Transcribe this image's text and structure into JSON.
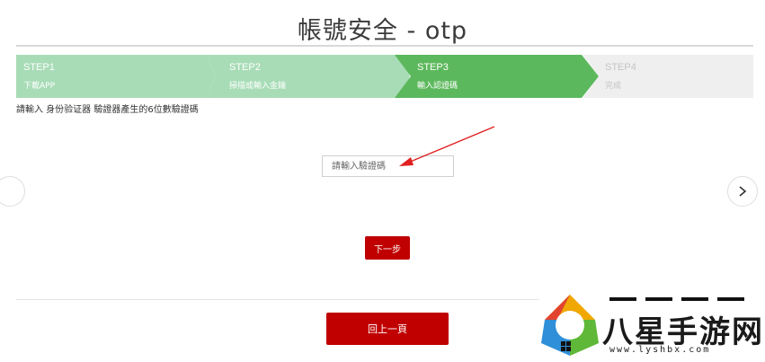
{
  "page": {
    "title": "帳號安全 - otp"
  },
  "steps": [
    {
      "label": "STEP1",
      "desc": "下載APP",
      "state": "done"
    },
    {
      "label": "STEP2",
      "desc": "掃描或輸入金鑰",
      "state": "done"
    },
    {
      "label": "STEP3",
      "desc": "輸入認證碼",
      "state": "active"
    },
    {
      "label": "STEP4",
      "desc": "完成",
      "state": "todo"
    }
  ],
  "instruction": "請輸入 身份验证器 驗證器產生的6位數驗證碼",
  "code_input": {
    "placeholder": "請輸入驗證碼",
    "value": ""
  },
  "buttons": {
    "next": "下一步",
    "back": "回上一頁"
  },
  "watermark": {
    "name": "八星手游网",
    "url": "www.lyshbx.com"
  },
  "colors": {
    "step_done": "#a8dcb7",
    "step_active": "#5cb85c",
    "step_todo": "#efefef",
    "button": "#c00000",
    "annotation_arrow": "#e02020"
  },
  "icons": {
    "nav_left": "chevron-left-icon",
    "nav_right": "chevron-right-icon",
    "annotation": "arrow-pointer-icon"
  }
}
